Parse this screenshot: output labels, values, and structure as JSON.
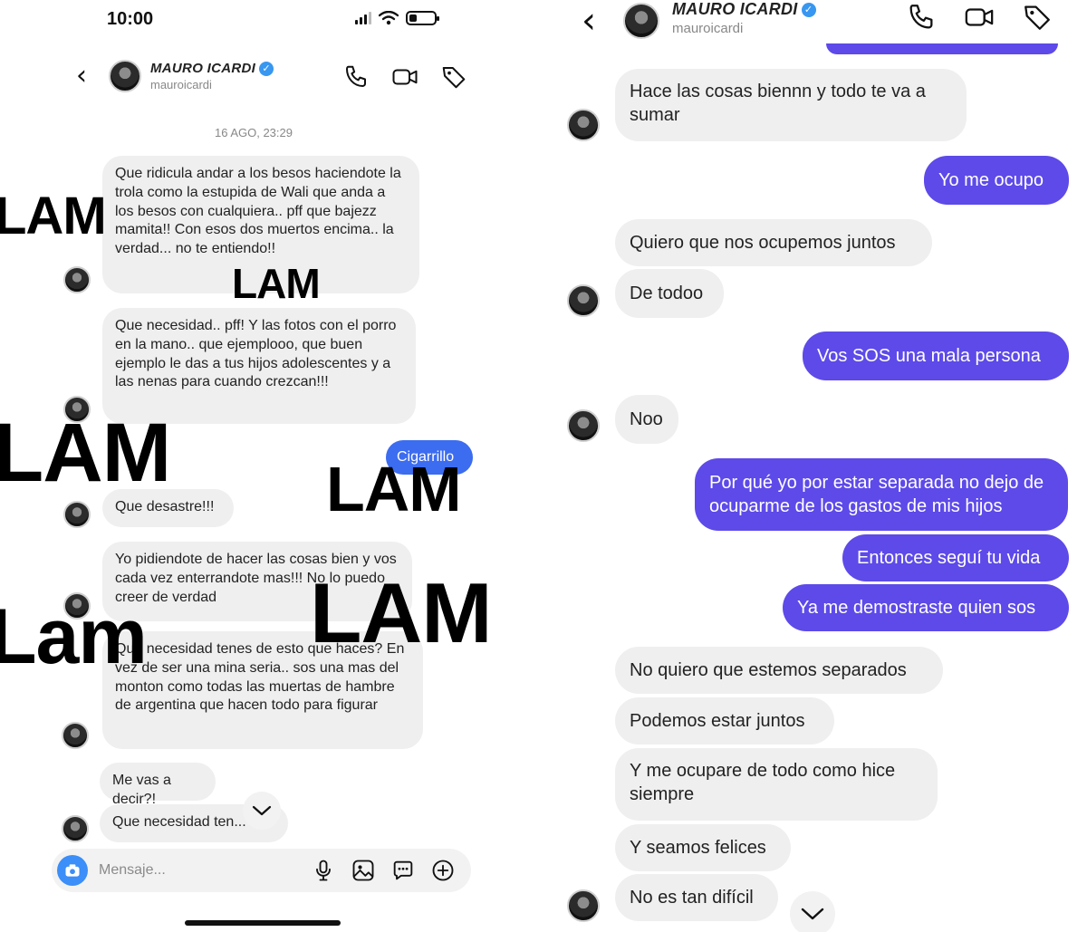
{
  "left": {
    "status_time": "10:00",
    "header": {
      "name": "MAURO ICARDI",
      "username": "mauroicardi"
    },
    "timestamp": "16 AGO, 23:29",
    "messages": [
      "Que ridicula andar a los besos haciendote la trola como la estupida de Wali que anda a los besos con cualquiera.. pff que bajezz mamita!! Con esos dos muertos encima.. la verdad... no te entiendo!!",
      "Que necesidad.. pff! Y las fotos con el porro en la mano.. que ejemplooo, que buen ejemplo le das a tus hijos adolescentes y a las nenas para cuando crezcan!!!",
      "Cigarrillo",
      "Que desastre!!!",
      "Yo pidiendote de hacer las cosas bien y vos cada vez enterrandote mas!!! No lo puedo creer de verdad",
      "Que necesidad tenes de esto que haces? En vez de ser una mina seria.. sos una mas del monton como todas las muertas de hambre de argentina que hacen todo para figurar",
      "Me vas a decir?!",
      "Que necesidad ten..."
    ],
    "composer_placeholder": "Mensaje..."
  },
  "right": {
    "header": {
      "name": "MAURO ICARDI",
      "username": "mauroicardi"
    },
    "messages": [
      "Hace las cosas biennn y todo te va a sumar",
      "Yo me ocupo",
      "Quiero que nos ocupemos juntos",
      "De todoo",
      "Vos SOS una mala persona",
      "Noo",
      "Por qué yo por estar separada no dejo de ocuparme de los gastos de mis hijos",
      "Entonces seguí tu vida",
      "Ya me demostraste quien sos",
      "No quiero que estemos separados",
      "Podemos estar juntos",
      "Y me ocupare de todo como hice siempre",
      "Y seamos felices",
      "No es tan difícil"
    ]
  },
  "watermarks": {
    "caps": "LAM",
    "mixed": "Lam"
  },
  "colors": {
    "outgoing": "#5d4ae9",
    "incoming": "#efefef",
    "verified": "#3897f0",
    "camera": "#3c8ef8"
  },
  "icons": [
    "back-icon",
    "verified-icon",
    "phone-icon",
    "video-icon",
    "tag-icon",
    "camera-icon",
    "mic-icon",
    "gallery-icon",
    "sticker-icon",
    "plus-icon",
    "chevron-down-icon"
  ]
}
